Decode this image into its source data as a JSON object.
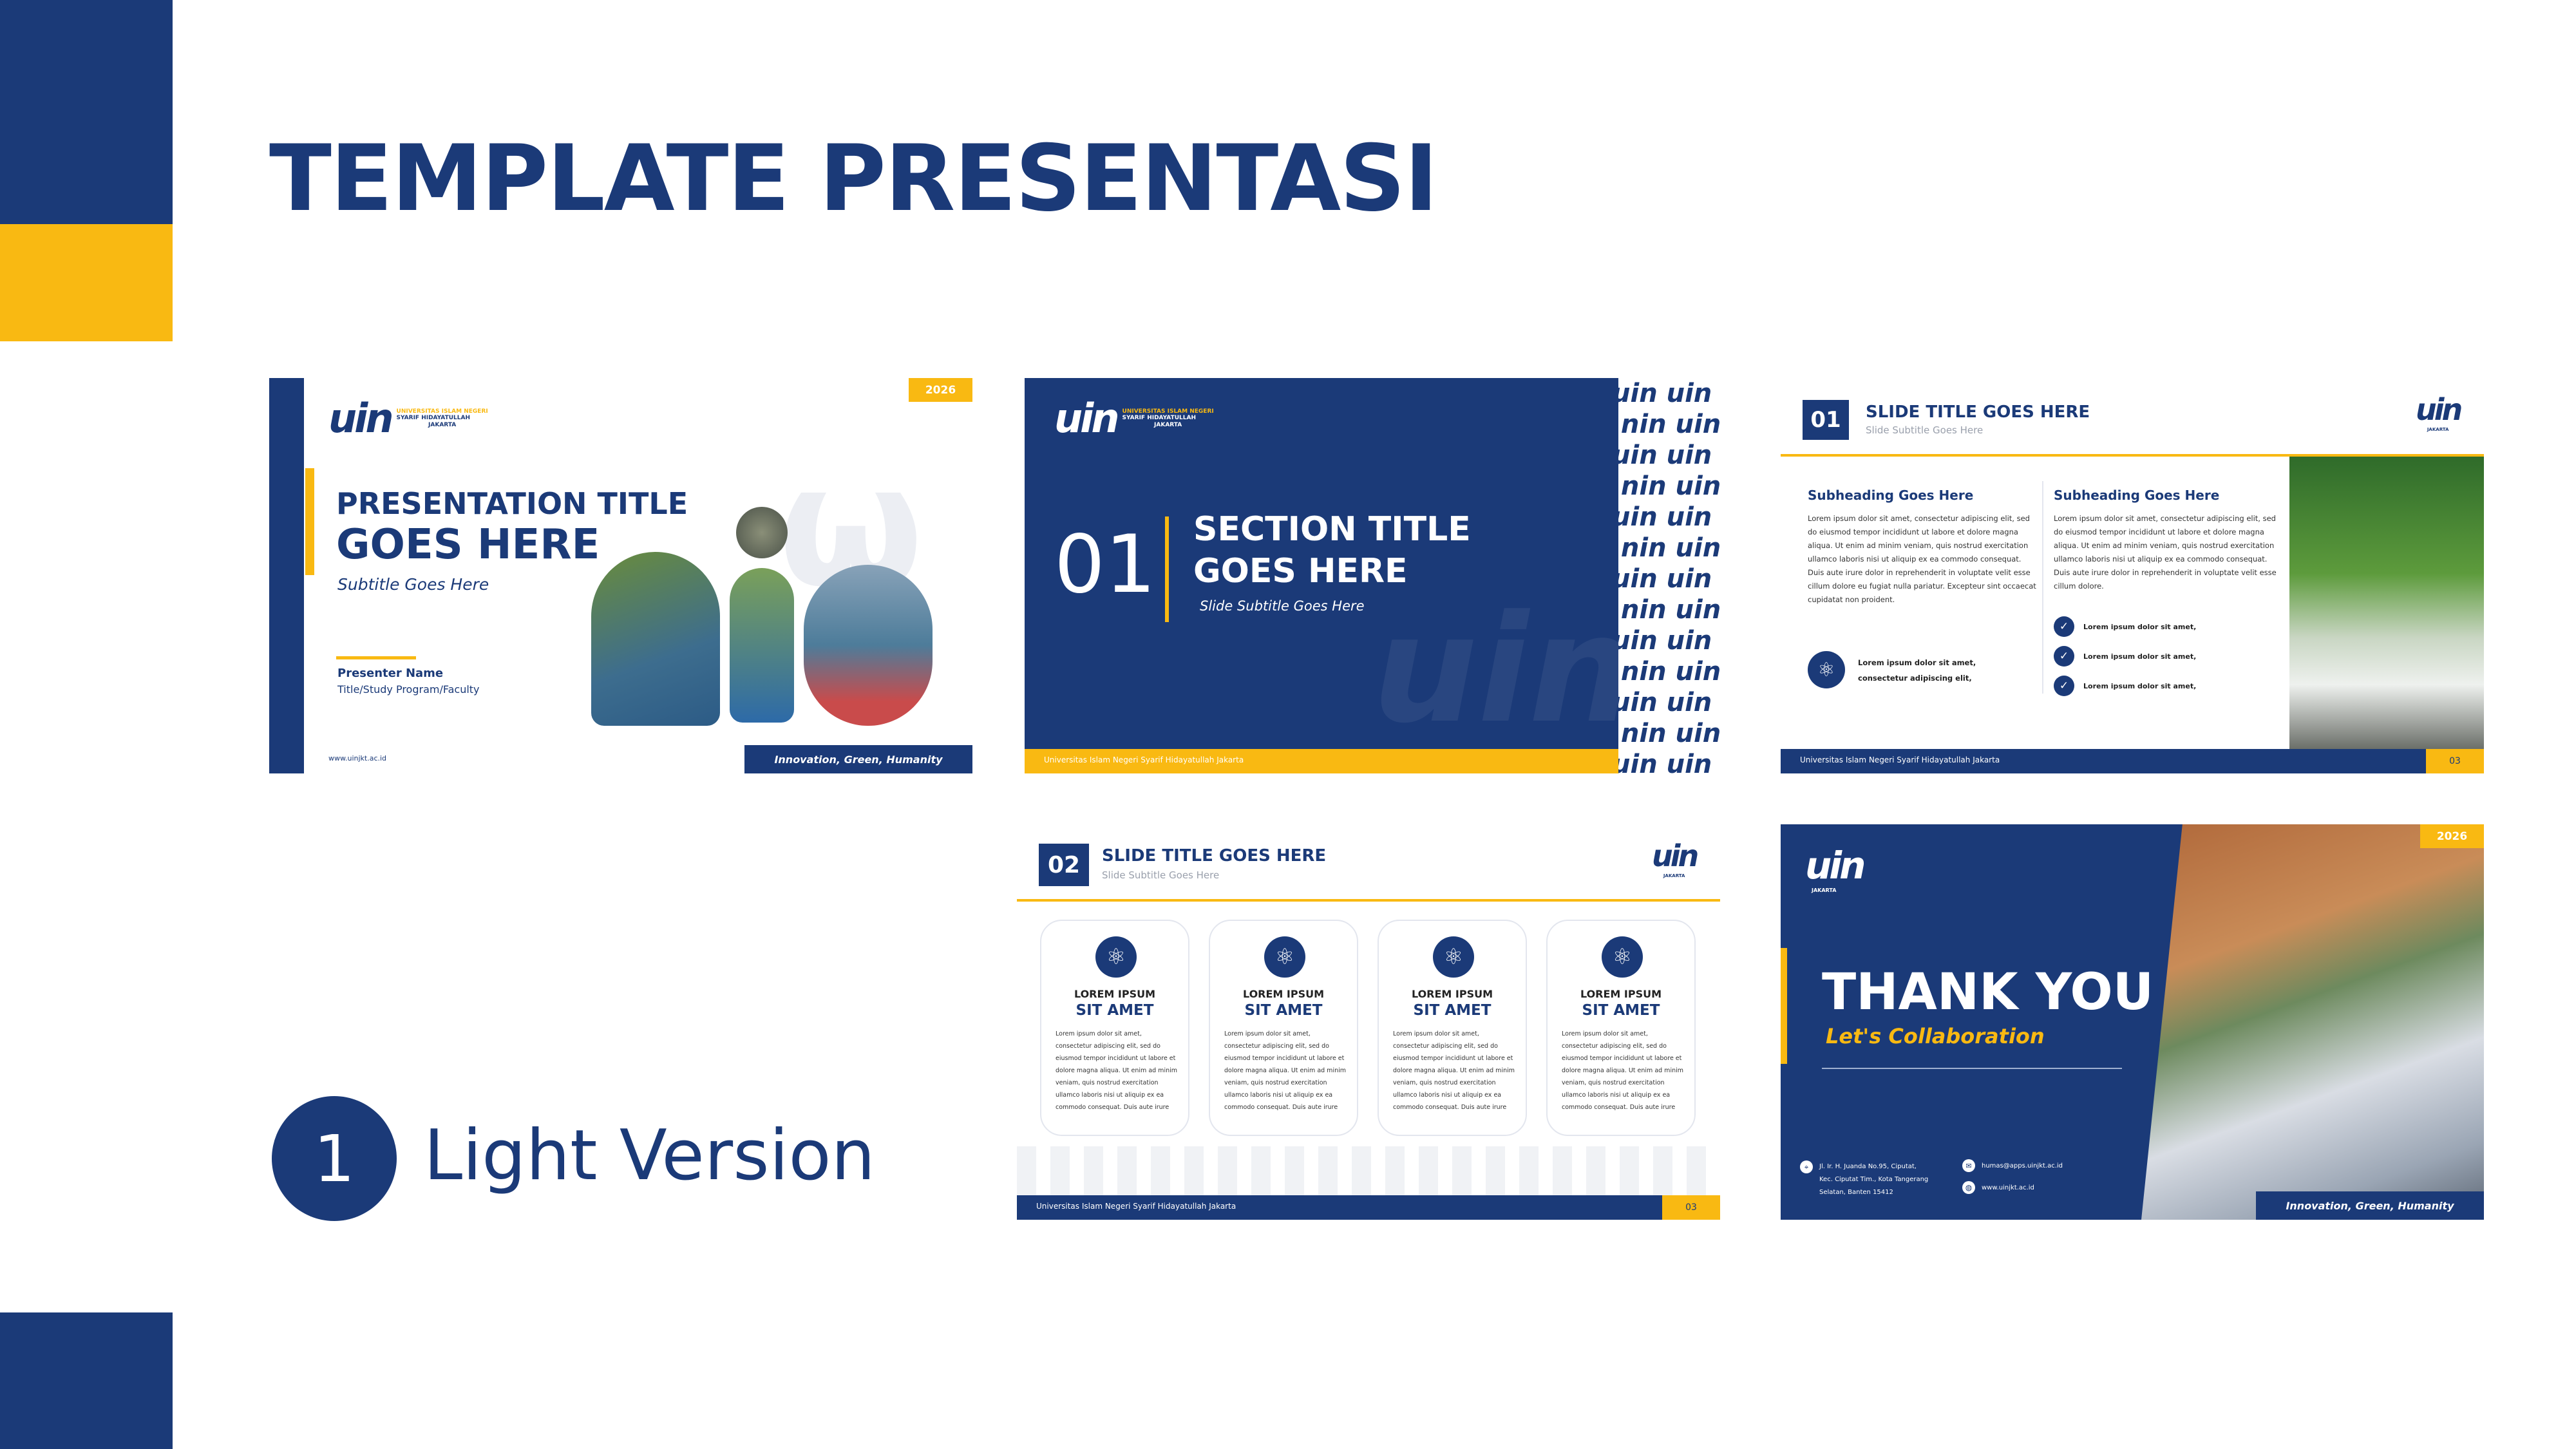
{
  "page": {
    "title": "TEMPLATE PRESENTASI",
    "version_number": "1",
    "version_label": "Light Version"
  },
  "colors": {
    "navy": "#1b3a78",
    "gold": "#f9b912",
    "white": "#ffffff"
  },
  "logo": {
    "mark": "uin",
    "line1": "UNIVERSITAS ISLAM NEGERI",
    "line2": "SYARIF HIDAYATULLAH",
    "line3": "JAKARTA"
  },
  "slide1": {
    "year": "2026",
    "title_line1": "PRESENTATION TITLE",
    "title_line2": "GOES HERE",
    "subtitle": "Subtitle Goes Here",
    "presenter_name": "Presenter Name",
    "presenter_role": "Title/Study Program/Faculty",
    "website": "www.uinjkt.ac.id",
    "tagline": "Innovation, Green, Humanity"
  },
  "slide2": {
    "number": "01",
    "title_line1": "SECTION TITLE",
    "title_line2": "GOES HERE",
    "subtitle": "Slide Subtitle Goes Here",
    "footer": "Universitas Islam Negeri Syarif Hidayatullah Jakarta"
  },
  "slide3": {
    "number": "01",
    "title": "SLIDE TITLE GOES HERE",
    "subtitle": "Slide Subtitle Goes Here",
    "col1_heading": "Subheading Goes Here",
    "col1_text": "Lorem ipsum dolor sit amet, consectetur adipiscing elit, sed do eiusmod tempor incididunt ut labore et dolore magna aliqua. Ut enim ad minim veniam, quis nostrud exercitation ullamco laboris nisi ut aliquip ex ea commodo consequat. Duis aute irure dolor in reprehenderit in voluptate velit esse cillum dolore eu fugiat nulla pariatur. Excepteur sint occaecat cupidatat non proident.",
    "col1_highlight_line1": "Lorem ipsum dolor sit amet,",
    "col1_highlight_line2": "consectetur adipiscing elit,",
    "col2_heading": "Subheading Goes Here",
    "col2_text": "Lorem ipsum dolor sit amet, consectetur adipiscing elit, sed do eiusmod tempor incididunt ut labore et dolore magna aliqua. Ut enim ad minim veniam, quis nostrud exercitation ullamco laboris nisi ut aliquip ex ea commodo consequat. Duis aute irure dolor in reprehenderit in voluptate velit esse cillum dolore.",
    "bullets": [
      "Lorem ipsum dolor sit amet,",
      "Lorem ipsum dolor sit amet,",
      "Lorem ipsum dolor sit amet,"
    ],
    "footer": "Universitas Islam Negeri Syarif Hidayatullah Jakarta",
    "page": "03"
  },
  "slide4": {
    "number": "02",
    "title": "SLIDE TITLE GOES HERE",
    "subtitle": "Slide Subtitle Goes Here",
    "cards": [
      {
        "label_small": "LOREM IPSUM",
        "label_big": "SIT AMET",
        "text": "Lorem ipsum dolor sit amet, consectetur adipiscing elit, sed do eiusmod tempor incididunt ut labore et dolore magna aliqua. Ut enim ad minim veniam, quis nostrud exercitation ullamco laboris nisi ut aliquip ex ea commodo consequat. Duis aute irure"
      },
      {
        "label_small": "LOREM IPSUM",
        "label_big": "SIT AMET",
        "text": "Lorem ipsum dolor sit amet, consectetur adipiscing elit, sed do eiusmod tempor incididunt ut labore et dolore magna aliqua. Ut enim ad minim veniam, quis nostrud exercitation ullamco laboris nisi ut aliquip ex ea commodo consequat. Duis aute irure"
      },
      {
        "label_small": "LOREM IPSUM",
        "label_big": "SIT AMET",
        "text": "Lorem ipsum dolor sit amet, consectetur adipiscing elit, sed do eiusmod tempor incididunt ut labore et dolore magna aliqua. Ut enim ad minim veniam, quis nostrud exercitation ullamco laboris nisi ut aliquip ex ea commodo consequat. Duis aute irure"
      },
      {
        "label_small": "LOREM IPSUM",
        "label_big": "SIT AMET",
        "text": "Lorem ipsum dolor sit amet, consectetur adipiscing elit, sed do eiusmod tempor incididunt ut labore et dolore magna aliqua. Ut enim ad minim veniam, quis nostrud exercitation ullamco laboris nisi ut aliquip ex ea commodo consequat. Duis aute irure"
      }
    ],
    "footer": "Universitas Islam Negeri Syarif Hidayatullah Jakarta",
    "page": "03"
  },
  "slide5": {
    "year": "2026",
    "title": "THANK YOU",
    "subtitle": "Let's Collaboration",
    "address_line1": "Jl. Ir. H. Juanda No.95, Ciputat,",
    "address_line2": "Kec. Ciputat Tim., Kota Tangerang",
    "address_line3": "Selatan, Banten 15412",
    "email": "humas@apps.uinjkt.ac.id",
    "website": "www.uinjkt.ac.id",
    "tagline": "Innovation, Green, Humanity"
  }
}
